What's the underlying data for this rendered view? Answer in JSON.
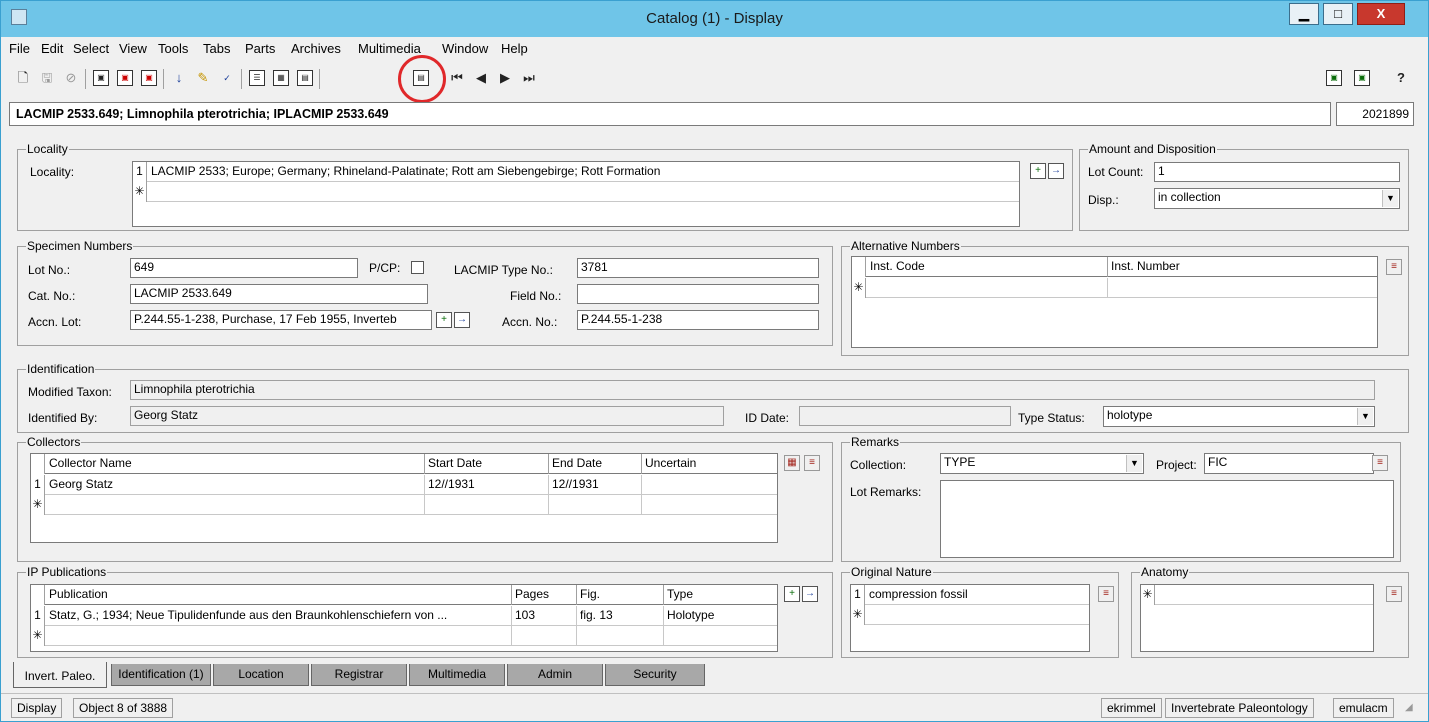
{
  "window": {
    "title": "Catalog (1) - Display",
    "minimize": "▁",
    "maximize": "□",
    "close": "X"
  },
  "menu": [
    "File",
    "Edit",
    "Select",
    "View",
    "Tools",
    "Tabs",
    "Parts",
    "Archives",
    "Multimedia",
    "Window",
    "Help"
  ],
  "record": {
    "summary": "LACMIP 2533.649; Limnophila pterotrichia; IPLACMIP 2533.649",
    "id": "2021899"
  },
  "locality": {
    "legend": "Locality",
    "label": "Locality:",
    "rows": [
      {
        "num": "1",
        "value": "LACMIP 2533; Europe; Germany; Rhineland-Palatinate; Rott am Siebengebirge; Rott Formation"
      },
      {
        "num": "✳",
        "value": ""
      }
    ]
  },
  "amount": {
    "legend": "Amount and Disposition",
    "lot_count_label": "Lot Count:",
    "lot_count": "1",
    "disp_label": "Disp.:",
    "disp": "in collection"
  },
  "specimen": {
    "legend": "Specimen Numbers",
    "lot_no_label": "Lot No.:",
    "lot_no": "649",
    "pcp_label": "P/CP:",
    "type_no_label": "LACMIP Type No.:",
    "type_no": "3781",
    "cat_no_label": "Cat. No.:",
    "cat_no": "LACMIP 2533.649",
    "field_no_label": "Field No.:",
    "field_no": "",
    "accn_lot_label": "Accn. Lot:",
    "accn_lot": "P.244.55-1-238, Purchase, 17 Feb 1955, Inverteb",
    "accn_no_label": "Accn. No.:",
    "accn_no": "P.244.55-1-238"
  },
  "alt_numbers": {
    "legend": "Alternative Numbers",
    "cols": [
      "Inst. Code",
      "Inst. Number"
    ],
    "new_row": "✳"
  },
  "identification": {
    "legend": "Identification",
    "taxon_label": "Modified Taxon:",
    "taxon": "Limnophila pterotrichia",
    "by_label": "Identified By:",
    "by": "Georg Statz",
    "date_label": "ID Date:",
    "date": "",
    "status_label": "Type Status:",
    "status": "holotype"
  },
  "collectors": {
    "legend": "Collectors",
    "cols": [
      "Collector Name",
      "Start Date",
      "End Date",
      "Uncertain"
    ],
    "rows": [
      {
        "num": "1",
        "name": "Georg Statz",
        "start": "12//1931",
        "end": "12//1931",
        "uncertain": ""
      }
    ],
    "new_row": "✳"
  },
  "remarks": {
    "legend": "Remarks",
    "collection_label": "Collection:",
    "collection": "TYPE",
    "project_label": "Project:",
    "project": "FIC",
    "lot_remarks_label": "Lot Remarks:"
  },
  "publications": {
    "legend": "IP Publications",
    "cols": [
      "Publication",
      "Pages",
      "Fig.",
      "Type"
    ],
    "rows": [
      {
        "num": "1",
        "pub": "Statz, G.; 1934; Neue Tipulidenfunde aus den Braunkohlenschiefern von ...",
        "pages": "103",
        "fig": "fig. 13",
        "type": "Holotype"
      }
    ],
    "new_row": "✳"
  },
  "nature": {
    "legend": "Original Nature",
    "rows": [
      {
        "num": "1",
        "value": "compression fossil"
      }
    ],
    "new_row": "✳"
  },
  "anatomy": {
    "legend": "Anatomy",
    "new_row": "✳"
  },
  "tabs": [
    "Invert. Paleo.",
    "Identification (1)",
    "Location",
    "Registrar",
    "Multimedia",
    "Admin",
    "Security"
  ],
  "status": {
    "mode": "Display",
    "position": "Object 8 of 3888",
    "user": "ekrimmel",
    "dept": "Invertebrate Paleontology",
    "host": "emulacm"
  }
}
